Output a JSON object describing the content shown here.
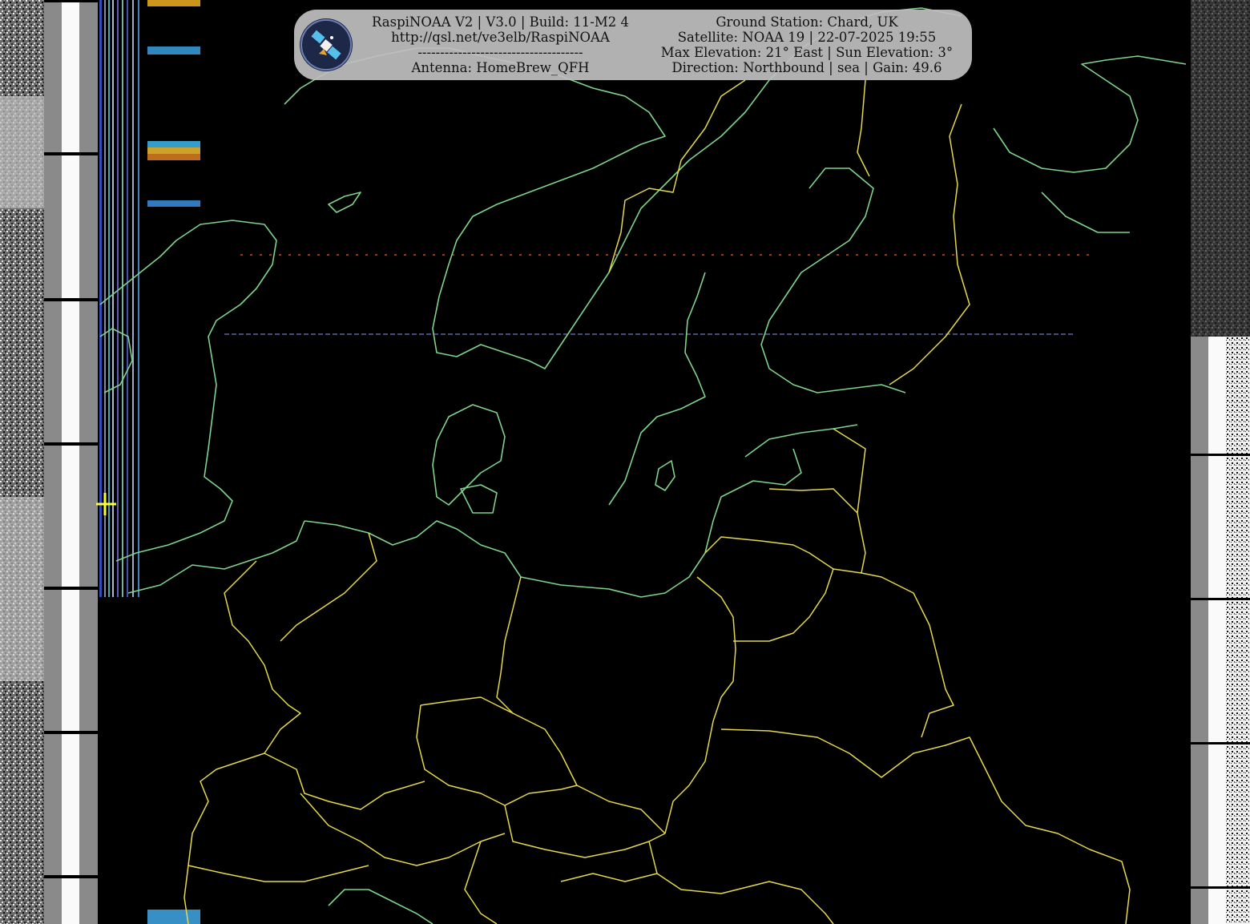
{
  "banner": {
    "left_lines": [
      "RaspiNOAA V2 | V3.0 | Build: 11-M2 4",
      "http://qsl.net/ve3elb/RaspiNOAA",
      "-------------------------------------",
      "Antenna: HomeBrew_QFH"
    ],
    "right_lines": [
      "Ground Station: Chard, UK",
      "Satellite: NOAA 19 | 22-07-2025 19:55",
      "Max Elevation: 21° East | Sun Elevation: 3°",
      "Direction: Northbound | sea | Gain: 49.6"
    ]
  },
  "colors": {
    "coastline": "#7fd38a",
    "borders": "#e6d84a",
    "station_marker": "#ffff33",
    "banner_bg": "#bebebe",
    "logo_bg": "#1d2748"
  },
  "icons": {
    "logo": "satellite-icon",
    "marker": "crosshair-icon"
  }
}
